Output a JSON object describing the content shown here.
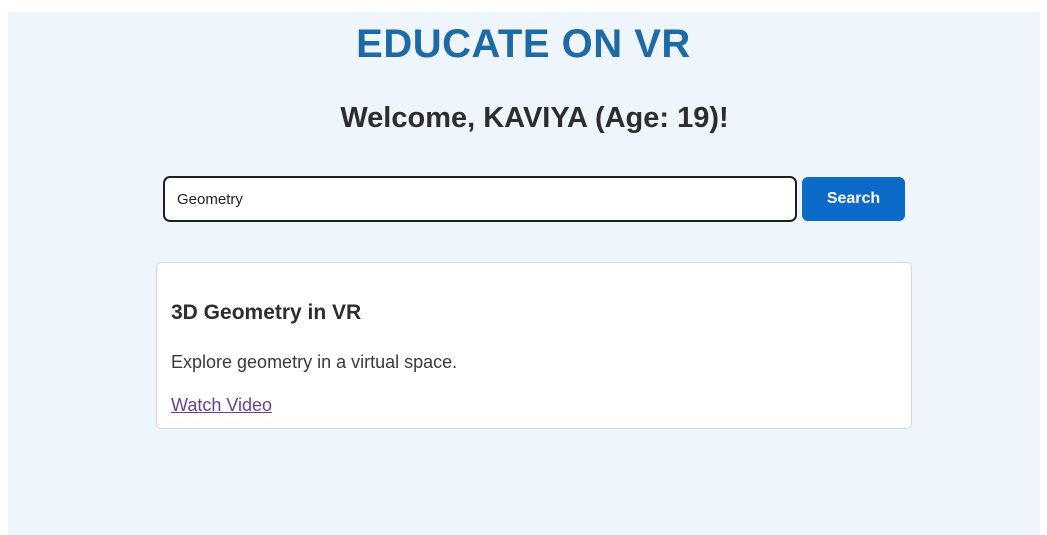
{
  "app": {
    "title": "EDUCATE ON VR"
  },
  "welcome": {
    "text": "Welcome, KAVIYA (Age: 19)!"
  },
  "search": {
    "value": "Geometry",
    "button_label": "Search"
  },
  "results": [
    {
      "title": "3D Geometry in VR",
      "description": "Explore geometry in a virtual space.",
      "link_label": "Watch Video"
    }
  ],
  "colors": {
    "title": "#1e6aa6",
    "background": "#eef5fc",
    "button": "#0c6ac9",
    "link": "#6b3e96"
  }
}
